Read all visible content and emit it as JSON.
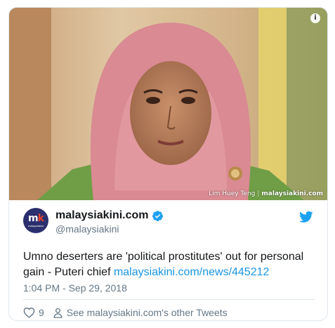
{
  "media": {
    "photo_credit": "Lim Huey Teng",
    "credit_brand": "malaysiakini.com",
    "info_icon": "info-icon"
  },
  "author": {
    "display_name": "malaysiakini.com",
    "handle": "@malaysiakini",
    "avatar_text": "mk",
    "avatar_subtext": "malaysiakini",
    "verified": true
  },
  "tweet": {
    "text": "Umno deserters are 'political prostitutes' out for personal gain - Puteri chief ",
    "link": "malaysiakini.com/news/445212",
    "timestamp": "1:04 PM - Sep 29, 2018"
  },
  "actions": {
    "like_count": "9",
    "profile_link": "See malaysiakini.com's other Tweets"
  },
  "colors": {
    "link": "#1b95e0",
    "secondary_text": "#657786",
    "twitter_blue": "#1da1f2",
    "border": "#e1e8ed",
    "avatar_bg": "#2b2f6e"
  }
}
